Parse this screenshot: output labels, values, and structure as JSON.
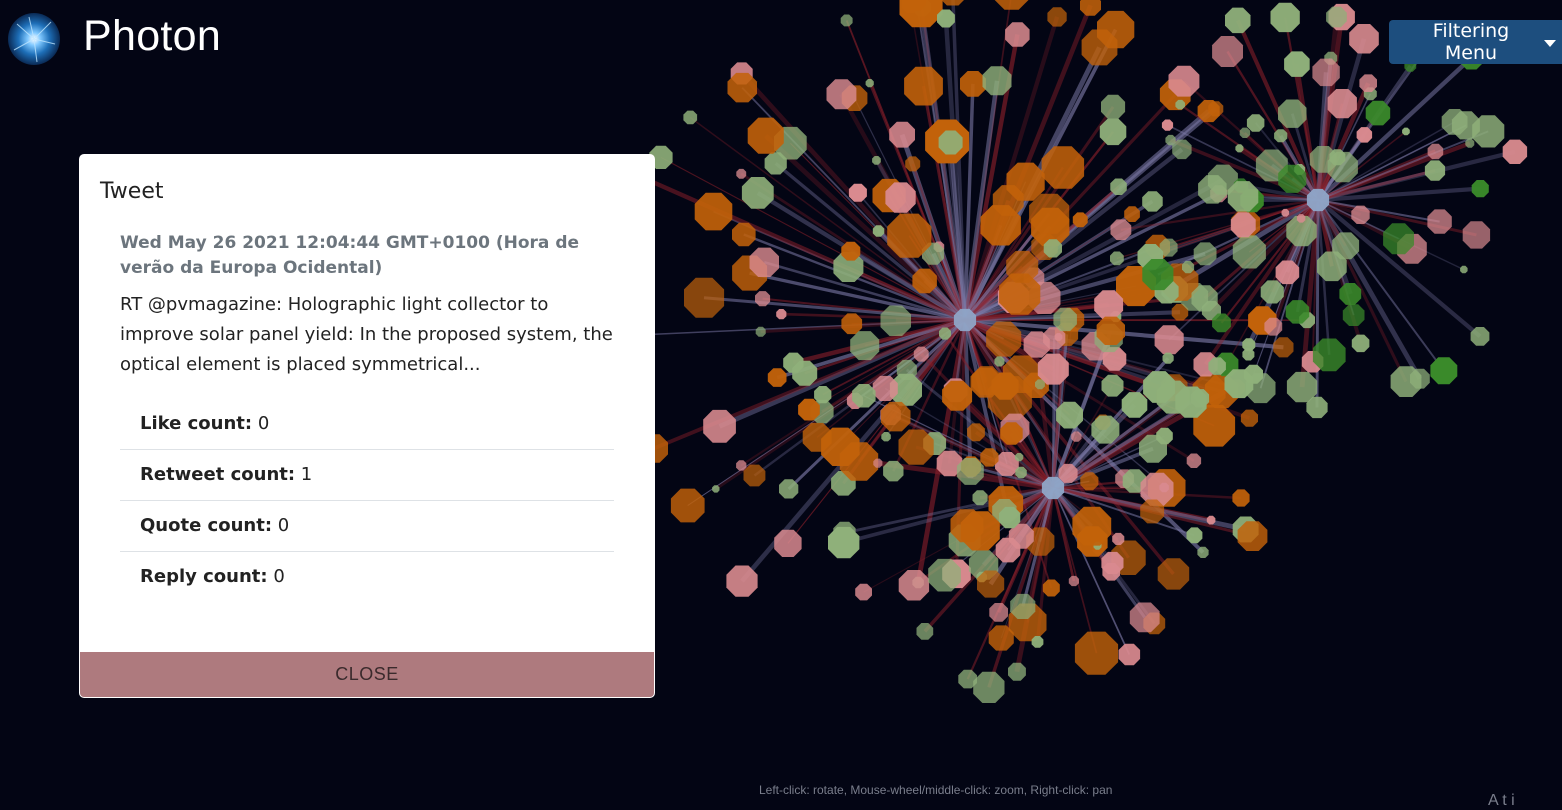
{
  "app": {
    "title": "Photon"
  },
  "header": {
    "filter_menu_label": "Filtering Menu"
  },
  "modal": {
    "title": "Tweet",
    "date": "Wed May 26 2021 12:04:44 GMT+0100 (Hora de verão da Europa Ocidental)",
    "text": "RT @pvmagazine: Holographic light collector to improve solar panel yield: In the proposed system, the optical element is placed symmetrical...",
    "stats": [
      {
        "label": "Like count:",
        "value": "0"
      },
      {
        "label": "Retweet count:",
        "value": "1"
      },
      {
        "label": "Quote count:",
        "value": "0"
      },
      {
        "label": "Reply count:",
        "value": "0"
      }
    ],
    "close_label": "CLOSE"
  },
  "footer": {
    "controls_hint": "Left-click: rotate, Mouse-wheel/middle-click: zoom, Right-click: pan",
    "corner_text": "A t i"
  },
  "colors": {
    "background": "#030514",
    "node_orange": "#c2620a",
    "node_green": "#8fb07a",
    "node_pink": "#d98a8f",
    "node_dark_green": "#3a8a2a",
    "node_blue": "#8fa6c8",
    "link_red": "#8a1f2a",
    "link_purple": "#7d7aa8",
    "close_button": "#ae7a7e",
    "filter_button": "#1d4e7e"
  }
}
